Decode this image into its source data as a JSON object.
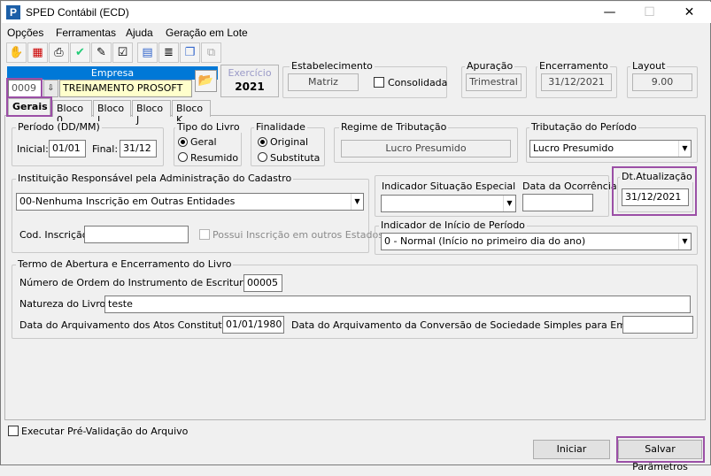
{
  "window": {
    "title": "SPED Contábil (ECD)"
  },
  "menu": [
    "Opções",
    "Ferramentas",
    "Ajuda",
    "Geração em Lote"
  ],
  "empresa": {
    "header": "Empresa",
    "code": "0009",
    "name": "TREINAMENTO PROSOFT"
  },
  "exercicio": {
    "label": "Exercício",
    "value": "2021"
  },
  "estabelecimento": {
    "label": "Estabelecimento",
    "value": "Matriz",
    "consolidada": "Consolidada"
  },
  "apuracao": {
    "label": "Apuração",
    "value": "Trimestral"
  },
  "encerramento": {
    "label": "Encerramento",
    "value": "31/12/2021"
  },
  "layout": {
    "label": "Layout",
    "value": "9.00"
  },
  "tabs": [
    "Gerais",
    "Bloco 0",
    "Bloco I",
    "Bloco J",
    "Bloco K"
  ],
  "periodo": {
    "label": "Período (DD/MM)",
    "inicial_label": "Inicial:",
    "inicial": "01/01",
    "final_label": "Final:",
    "final": "31/12"
  },
  "tipo_livro": {
    "label": "Tipo do Livro",
    "geral": "Geral",
    "resumido": "Resumido"
  },
  "finalidade": {
    "label": "Finalidade",
    "original": "Original",
    "substituta": "Substituta"
  },
  "regime": {
    "label": "Regime de Tributação",
    "value": "Lucro Presumido"
  },
  "tributacao": {
    "label": "Tributação do Período",
    "value": "Lucro Presumido"
  },
  "instituicao": {
    "label": "Instituição Responsável pela Administração do Cadastro",
    "value": "00-Nenhuma Inscrição em Outras Entidades",
    "cod_label": "Cod. Inscrição",
    "possui": "Possui Inscrição em outros Estados"
  },
  "situacao": {
    "indicador_label": "Indicador Situação Especial",
    "data_label": "Data da Ocorrência"
  },
  "dt_atualizacao": {
    "label": "Dt.Atualização",
    "value": "31/12/2021"
  },
  "inicio_periodo": {
    "label": "Indicador de Início de Período",
    "value": "0 - Normal (Início no primeiro dia do ano)"
  },
  "termo": {
    "label": "Termo de Abertura e Encerramento do Livro",
    "ordem_label": "Número de Ordem do Instrumento de Escrituração:",
    "ordem": "00005",
    "natureza_label": "Natureza do Livro:",
    "natureza": "teste",
    "arquivamento_label": "Data do Arquivamento dos Atos Constitutivos:",
    "arquivamento": "01/01/1980",
    "conversao_label": "Data do Arquivamento da Conversão de Sociedade Simples para Empresária:"
  },
  "prevalidacao": "Executar Pré-Validação do Arquivo",
  "buttons": {
    "iniciar": "Iniciar",
    "salvar": "Salvar Parâmetros"
  },
  "colors": {
    "highlight": "#9b4fa6",
    "empresa_header": "#0078d7",
    "name_field": "#ffffcc"
  }
}
